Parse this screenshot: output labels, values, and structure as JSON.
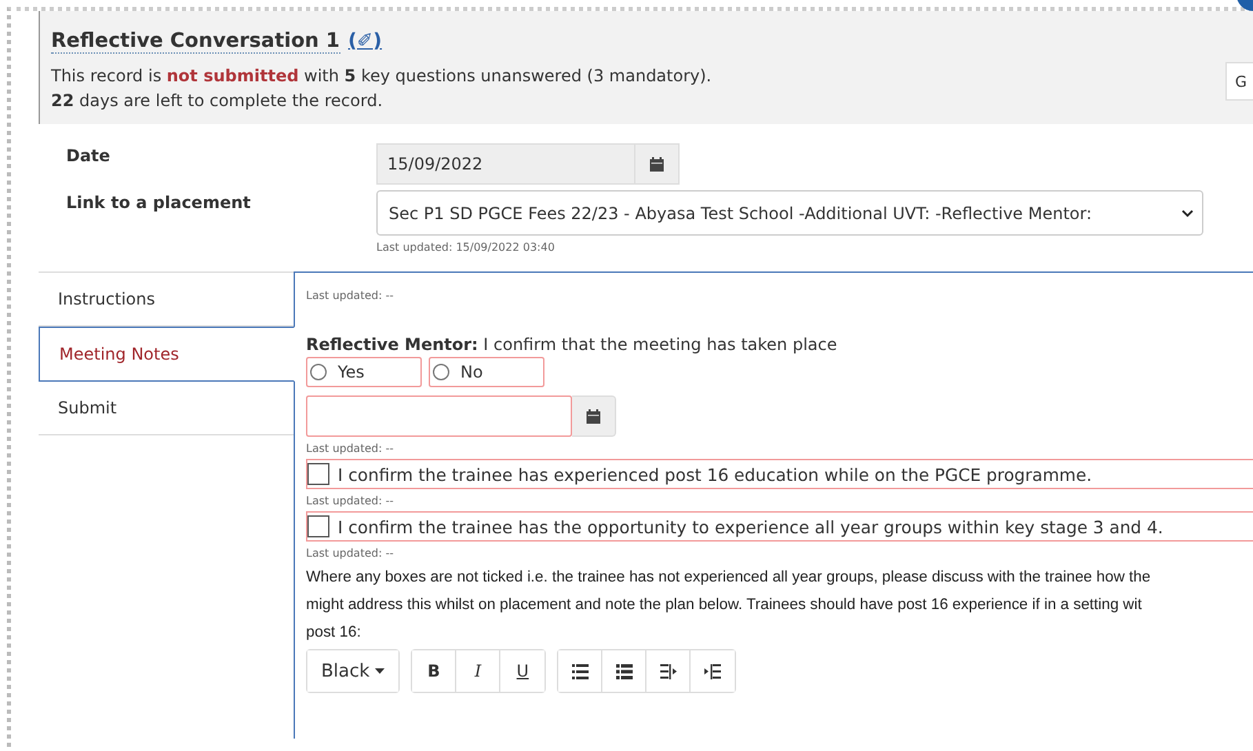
{
  "header": {
    "title": "Reflective Conversation 1",
    "edit_link": "(✐)",
    "status_parts": [
      {
        "kind": "plain",
        "text": "This record is "
      },
      {
        "kind": "alert",
        "text": "not submitted"
      },
      {
        "kind": "plain",
        "text": " with "
      },
      {
        "kind": "bold",
        "text": "5"
      },
      {
        "kind": "plain",
        "text": " key questions unanswered (3 mandatory)."
      }
    ],
    "days_parts": [
      {
        "kind": "bold",
        "text": "22"
      },
      {
        "kind": "plain",
        "text": " days are left to complete the record."
      }
    ],
    "side_button": "G"
  },
  "form": {
    "date_label": "Date",
    "date_value": "15/09/2022",
    "placement_label": "Link to a placement",
    "placement_value": "Sec P1 SD PGCE Fees 22/23 - Abyasa Test School -Additional UVT: -Reflective Mentor:",
    "last_updated": "Last updated: 15/09/2022 03:40"
  },
  "tabs": [
    {
      "label": "Instructions",
      "selected": false
    },
    {
      "label": "Meeting Notes",
      "selected": true
    },
    {
      "label": "Submit",
      "selected": false
    }
  ],
  "content": {
    "last_updated_top": "Last updated: --",
    "question_role": "Reflective Mentor:",
    "question_text": " I confirm that the meeting has taken place",
    "options": [
      {
        "label": "Yes",
        "selected": false
      },
      {
        "label": "No",
        "selected": false
      }
    ],
    "last_updated_date": "Last updated: --",
    "checks": [
      {
        "label": "I confirm the trainee has experienced post 16 education while on the PGCE programme.",
        "checked": false,
        "last_updated": "Last updated: --"
      },
      {
        "label": "I confirm the trainee has the opportunity to experience all year groups within key stage 3 and 4.",
        "checked": false,
        "last_updated": "Last updated: --"
      }
    ],
    "instruction_lines": [
      "Where any boxes are not ticked i.e. the trainee has not experienced all year groups, please discuss with the trainee how the",
      "might address this whilst on placement and note the plan below. Trainees should have post 16 experience if in a setting wit",
      "post 16:"
    ],
    "toolbar": {
      "font_color_label": "Black",
      "format": [
        "B",
        "I",
        "U"
      ]
    }
  }
}
